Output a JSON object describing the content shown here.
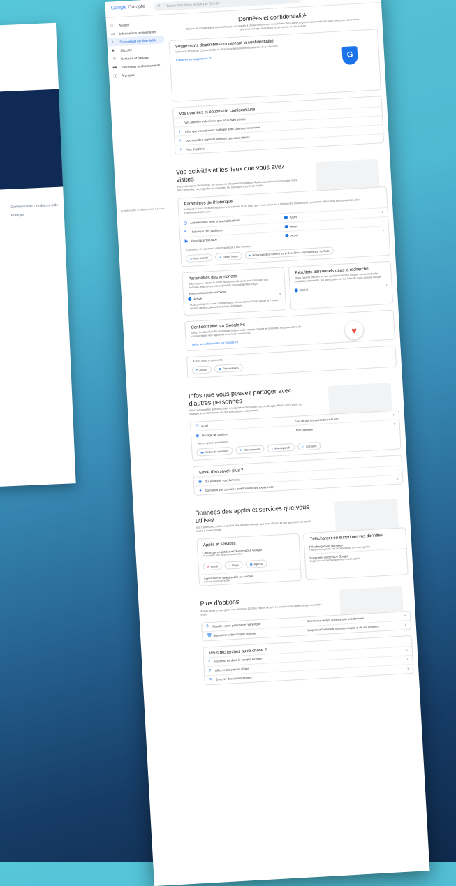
{
  "header": {
    "logo_google": "Google",
    "logo_product": "Compte",
    "search_placeholder": "Rechercher dans le compte Google"
  },
  "sidebar": {
    "items": [
      {
        "label": "Accueil",
        "icon": "home-icon"
      },
      {
        "label": "Informations personnelles",
        "icon": "id-card-icon"
      },
      {
        "label": "Données et confidentialité",
        "icon": "toggle-icon",
        "active": true
      },
      {
        "label": "Sécurité",
        "icon": "lock-icon"
      },
      {
        "label": "Contacts et partage",
        "icon": "people-icon"
      },
      {
        "label": "Paiements et abonnements",
        "icon": "card-icon"
      },
      {
        "label": "À propos",
        "icon": "info-icon"
      }
    ],
    "footer": "Confidentialité   Conditions   Aide   À propos"
  },
  "page": {
    "title": "Données et confidentialité",
    "subtitle": "Options de confidentialité essentielles pour vous aider à choisir les données enregistrées dans votre compte, les annonces que vous voyez, les informations que vous partagez avec d'autres personnes, et plus encore"
  },
  "suggestions": {
    "title": "Suggestions disponibles concernant la confidentialité",
    "desc": "Utilisez le Check-up Confidentialité et choisissez les paramètres adaptés à vos besoins",
    "link": "Examiner les suggestions (2)"
  },
  "options": {
    "title": "Vos données et options de confidentialité",
    "items": [
      "Vos activités et les lieux que vous avez visités",
      "Infos que vous pouvez partager avec d'autres personnes",
      "Données des applis et services que vous utilisez",
      "Plus d'options"
    ]
  },
  "activity": {
    "title": "Vos activités et les lieux que vous avez visités",
    "desc": "Vos options pour l'historique, les annonces et la personnalisation. Redécouvrez les contenus que vous avez cherchés, lus, regardés, et consultez les lieux que vous avez visités",
    "history_card": {
      "title": "Paramètres de l'historique",
      "desc": "Indiquez si vous voulez enregistrer vos activités et les lieux que vous visitez pour obtenir des résultats plus pertinents, des cartes personnalisées, des recommandations, etc.",
      "rows": [
        {
          "label": "Activité sur le Web et les applications",
          "status": "Activé"
        },
        {
          "label": "Historique des positions",
          "status": "Activé"
        },
        {
          "label": "Historique YouTube",
          "status": "Activé"
        }
      ],
      "note": "Consultez et supprimez votre historique à tout moment",
      "chips": [
        "Mon activité",
        "Trajets Maps",
        "Historique des recherches et des vidéos regardées sur YouTube"
      ]
    },
    "ads_card": {
      "title": "Paramètres des annonces",
      "desc": "Vous pouvez choisir le mode de personnalisation des annonces (par exemple, selon vos centres d'intérêt ou vos tranches d'âge)",
      "label": "Personnalisation des annonces",
      "status": "Activé",
      "note": "Nous protégeons votre confidentialité. Vos contenus Drive, Gmail et Photos ne sont jamais utilisés à des fins publicitaires"
    },
    "results_card": {
      "title": "Résultats personnels dans la recherche",
      "desc": "Vous pouvez décider ou non que la recherche Google vous montre des résultats personnels, qui sont basés sur les infos de votre compte Google",
      "status": "Activé"
    },
    "fit_card": {
      "title": "Confidentialité sur Google Fit",
      "desc": "Gérez les données Fit enregistrées dans votre compte Google et consultez les paramètres de confidentialité des appareils et services connectés",
      "link": "Gérer la confidentialité sur Google Fit"
    },
    "more_label": "Autres options pertinentes",
    "more_chips": [
      "Achats",
      "Réservations"
    ]
  },
  "sharing": {
    "title": "Infos que vous pouvez partager avec d'autres personnes",
    "desc": "Infos personnelles que vous avez enregistrées dans votre compte Google. Faites votre choix de partager vos informations ou non avec d'autres personnes",
    "rows": [
      {
        "label": "Profil",
        "value": "Voir ce que les autres peuvent voir"
      },
      {
        "label": "Partage de position",
        "value": "Non partagée"
      }
    ],
    "more_label": "Autres options pertinentes",
    "chips": [
      "Modes de paiement",
      "Abonnements",
      "Vos appareils",
      "Contacts"
    ]
  },
  "learn_more": {
    "title": "Envie d'en savoir plus ?",
    "items": [
      "Qui peut voir vos données",
      "Comment vos données améliorent votre expérience"
    ]
  },
  "apps": {
    "title": "Données des applis et services que vous utilisez",
    "desc": "Vos contenus et préférences liés aux services Google que vous utilisez et aux applis tierces ayant accès à votre compte",
    "apps_card": {
      "title": "Applis et services",
      "row_title": "Contenu enregistré avec les services Google",
      "row_desc": "Résumé de vos services et données",
      "chips": [
        "Gmail",
        "Maps",
        "Agenda"
      ],
      "third_title": "Applis tierces ayant accès au compte",
      "third_desc": "Aucune appli connectée"
    },
    "download_card": {
      "title": "Télécharger ou supprimer vos données",
      "row1_title": "Télécharger vos données",
      "row1_desc": "Faites une copie de vos données pour les sauvegarder",
      "row2_title": "Supprimer un service Google",
      "row2_desc": "Supprimez un service que vous n'utilisez plus"
    }
  },
  "more_options": {
    "title": "Plus d'options",
    "desc": "Autres options pour gérer vos données. Comme choisir ce qu'il en sera lorsque votre compte deviendra inactif",
    "rows": [
      {
        "label": "Planifier votre patrimoine numérique",
        "value": "Déterminez ce qu'il adviendra de vos données"
      },
      {
        "label": "Supprimer votre compte Google",
        "value": "Supprimez l'intégralité de votre compte et de vos données"
      }
    ]
  },
  "other": {
    "title": "Vous recherchez autre chose ?",
    "items": [
      "Rechercher dans le compte Google",
      "Afficher les options d'aide",
      "Envoyer des commentaires"
    ]
  },
  "backcard": {
    "footer": "Confidentialité   Conditions   Aide",
    "line2": "Français"
  }
}
